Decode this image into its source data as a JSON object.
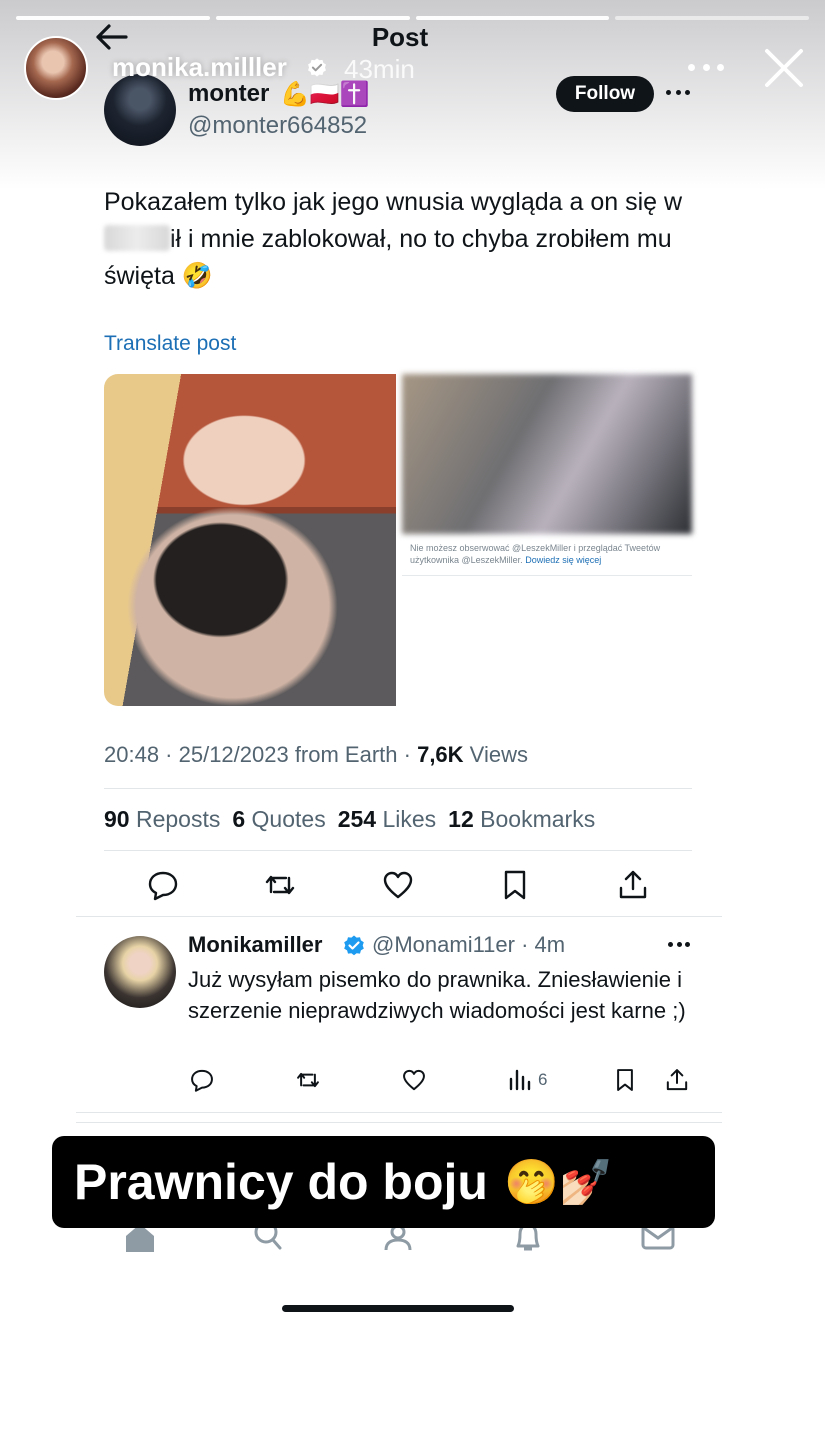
{
  "story": {
    "username": "monika.milller",
    "time_ago": "43min",
    "icons": [
      "avatar",
      "verified-icon",
      "more-icon",
      "close-icon"
    ]
  },
  "post_header": {
    "title": "Post"
  },
  "tweet": {
    "display_name": "monter",
    "name_emoji": "💪🇵🇱✝️",
    "handle": "@monter664852",
    "follow_label": "Follow",
    "text_part1": "Pokazałem tylko jak jego wnusia wygląda a on się w",
    "text_part2": "ił i mnie zablokował, no to chyba zrobiłem mu święta 🤣",
    "translate_label": "Translate post",
    "media_caption_text": "Nie możesz obserwować @LeszekMiller i przeglądać Tweetów użytkownika @LeszekMiller.",
    "media_caption_link": "Dowiedz się więcej",
    "time": "20:48 · 25/12/2023 from Earth · ",
    "views_count": "7,6K",
    "views_label": " Views",
    "stats": [
      {
        "count": "90",
        "label": "Reposts"
      },
      {
        "count": "6",
        "label": "Quotes"
      },
      {
        "count": "254",
        "label": "Likes"
      },
      {
        "count": "12",
        "label": "Bookmarks"
      }
    ]
  },
  "reply": {
    "display_name": "Monikamiller",
    "handle_time": "@Monami11er · 4m",
    "text": "Już wysyłam pisemko do prawnika. Zniesławienie i szerzenie nieprawdziwych wiadomości jest karne ;)",
    "views": "6"
  },
  "sticker": {
    "text": "Prawnicy do boju",
    "emoji": "🤭💅🏻"
  },
  "colors": {
    "link": "#1d6fb5",
    "verified": "#1d9bf0",
    "text": "#0f1419",
    "muted": "#536471"
  }
}
